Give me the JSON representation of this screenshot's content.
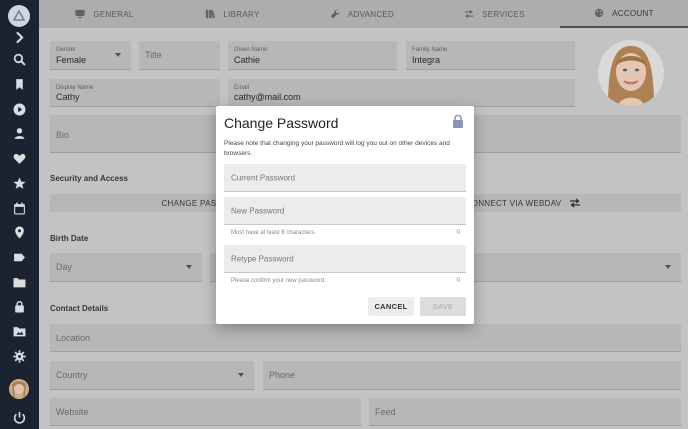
{
  "tabs": [
    {
      "label": "GENERAL",
      "icon": "monitor-icon"
    },
    {
      "label": "LIBRARY",
      "icon": "books-icon"
    },
    {
      "label": "ADVANCED",
      "icon": "wrench-icon"
    },
    {
      "label": "SERVICES",
      "icon": "swap-icon"
    },
    {
      "label": "ACCOUNT",
      "icon": "palette-icon",
      "active": true
    }
  ],
  "sidebar": {
    "items": [
      "search-icon",
      "bookmark-icon",
      "play-icon",
      "person-icon",
      "heart-icon",
      "star-icon",
      "calendar-icon",
      "location-icon",
      "label-icon",
      "folder-icon",
      "lock-icon",
      "folder-photo-icon",
      "settings-icon"
    ],
    "bottom": [
      "avatar",
      "power-icon"
    ]
  },
  "form": {
    "gender": {
      "label": "Gender",
      "value": "Female"
    },
    "title": {
      "placeholder": "Title"
    },
    "given_name": {
      "label": "Given Name",
      "value": "Cathie"
    },
    "family_name": {
      "label": "Family Name",
      "value": "Integra"
    },
    "display_name": {
      "label": "Display Name",
      "value": "Cathy"
    },
    "email": {
      "label": "Email",
      "value": "cathy@mail.com"
    },
    "bio": {
      "placeholder": "Bio"
    },
    "security_heading": "Security and Access",
    "change_password_btn": "CHANGE PASSWORD",
    "webdav_btn": "CONNECT VIA WEBDAV",
    "birth_date_heading": "Birth Date",
    "day": {
      "placeholder": "Day"
    },
    "contact_heading": "Contact Details",
    "location": {
      "placeholder": "Location"
    },
    "country": {
      "placeholder": "Country"
    },
    "phone": {
      "placeholder": "Phone"
    },
    "website": {
      "placeholder": "Website"
    },
    "feed": {
      "placeholder": "Feed"
    }
  },
  "dialog": {
    "title": "Change Password",
    "note": "Please note that changing your password will log you out on other devices and browsers.",
    "current": {
      "placeholder": "Current Password"
    },
    "new": {
      "placeholder": "New Password",
      "hint": "Must have at least 8 characters.",
      "count": "0"
    },
    "retype": {
      "placeholder": "Retype Password",
      "hint": "Please confirm your new password.",
      "count": "0"
    },
    "cancel_label": "CANCEL",
    "save_label": "SAVE"
  },
  "colors": {
    "sidebar": "#1d2633",
    "accent": "#6b7fa3"
  }
}
